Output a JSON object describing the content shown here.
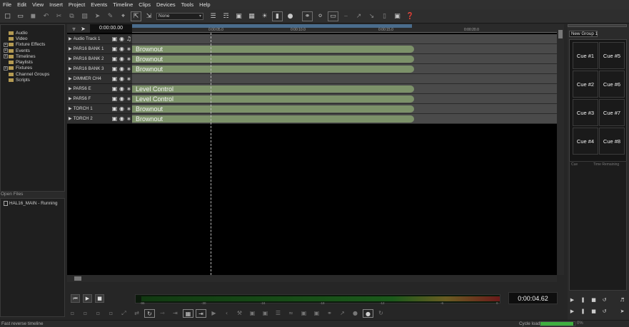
{
  "menu": [
    "File",
    "Edit",
    "View",
    "Insert",
    "Project",
    "Events",
    "Timeline",
    "Clips",
    "Devices",
    "Tools",
    "Help"
  ],
  "toolbar": {
    "dropdown_value": "None"
  },
  "tree": [
    {
      "label": "Audio",
      "expandable": false
    },
    {
      "label": "Video",
      "expandable": false
    },
    {
      "label": "Fixture Effects",
      "expandable": true
    },
    {
      "label": "Events",
      "expandable": true
    },
    {
      "label": "Timelines",
      "expandable": true
    },
    {
      "label": "Playlists",
      "expandable": false
    },
    {
      "label": "Fixtures",
      "expandable": true
    },
    {
      "label": "Channel Groups",
      "expandable": false
    },
    {
      "label": "Scripts",
      "expandable": false
    }
  ],
  "open_files": {
    "header": "Open Files",
    "items": [
      "HAL16_MAIN - Running"
    ]
  },
  "timeline": {
    "timecode": "0:00:00.00",
    "ruler_labels": [
      "0:00:05.0",
      "0:00:10.0",
      "0:00:15.0",
      "0:00:20.0"
    ],
    "tracks": [
      {
        "name": "Audio Track 1",
        "clip": ""
      },
      {
        "name": "PAR16 BANK 1",
        "clip": "Brownout"
      },
      {
        "name": "PAR16 BANK 2",
        "clip": "Brownout"
      },
      {
        "name": "PAR16 BANK 3",
        "clip": "Brownout"
      },
      {
        "name": "DIMMER CH4",
        "clip": ""
      },
      {
        "name": "PAR56 E",
        "clip": "Level Control"
      },
      {
        "name": "PAR56 F",
        "clip": "Level Control"
      },
      {
        "name": "TORCH 1",
        "clip": "Brownout"
      },
      {
        "name": "TORCH 2",
        "clip": "Brownout"
      }
    ]
  },
  "transport": {
    "clock": "0:00:04.62",
    "meter_scale": [
      "-96",
      "-30",
      "-24",
      "-18",
      "-12",
      "-6",
      "0"
    ]
  },
  "cues": {
    "group_tab": "New Group 1",
    "buttons": [
      "Cue #1",
      "Cue #5",
      "Cue #2",
      "Cue #6",
      "Cue #3",
      "Cue #7",
      "Cue #4",
      "Cue #8"
    ],
    "list_headers": [
      "Cue",
      "Time Remaining"
    ]
  },
  "status": {
    "text": "Fast reverse timeline",
    "cycle_label": "Cycle load",
    "cycle_value": "0%",
    "cycle_fraction": 0.95
  },
  "colors": {
    "clip": "#7c9169",
    "track_lane": "#4a4a4a",
    "folder": "#b49a52",
    "cycle": "#3fae3f"
  }
}
